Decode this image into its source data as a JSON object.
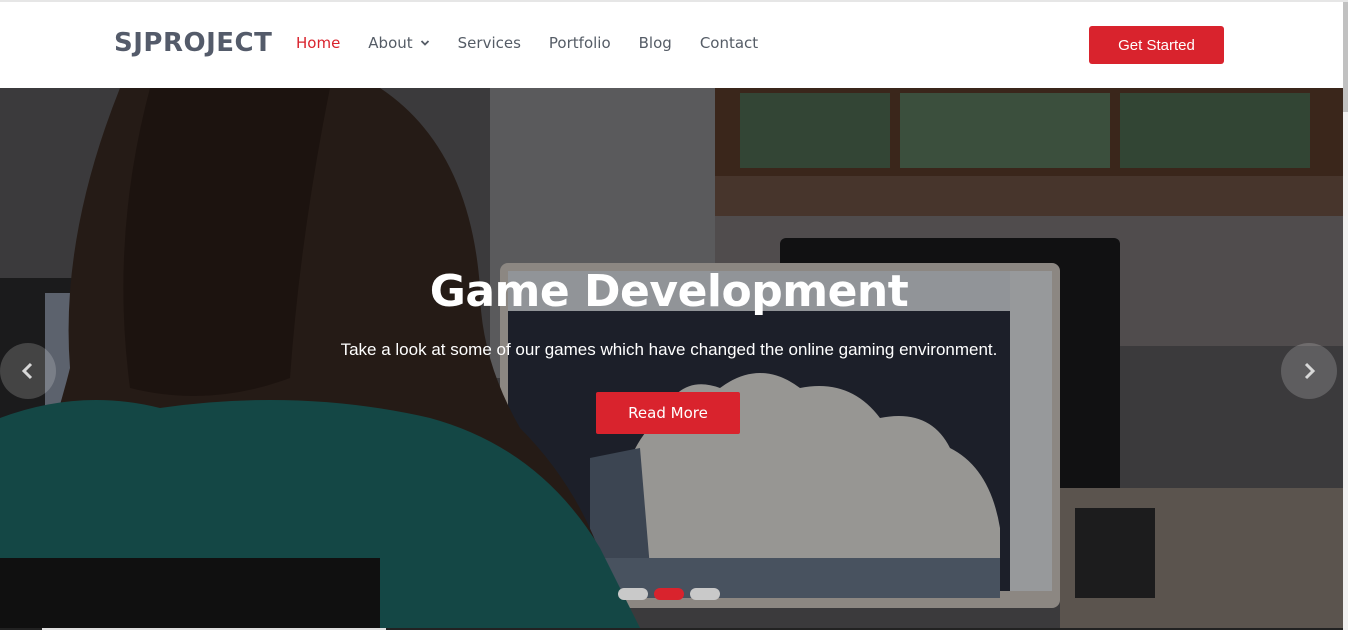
{
  "brand": {
    "logo": "SJPROJECT",
    "accent_color": "#d9232d",
    "text_color": "#555c66"
  },
  "nav": {
    "items": [
      {
        "label": "Home",
        "active": true
      },
      {
        "label": "About",
        "active": false,
        "has_dropdown": true
      },
      {
        "label": "Services",
        "active": false
      },
      {
        "label": "Portfolio",
        "active": false
      },
      {
        "label": "Blog",
        "active": false
      },
      {
        "label": "Contact",
        "active": false
      }
    ],
    "cta_label": "Get Started"
  },
  "hero": {
    "title": "Game Development",
    "subtitle": "Take a look at some of our games which have changed the online gaming environment.",
    "button_label": "Read More",
    "prev_icon": "chevron-left-icon",
    "next_icon": "chevron-right-icon",
    "slides_count": 3,
    "active_slide": 2
  }
}
